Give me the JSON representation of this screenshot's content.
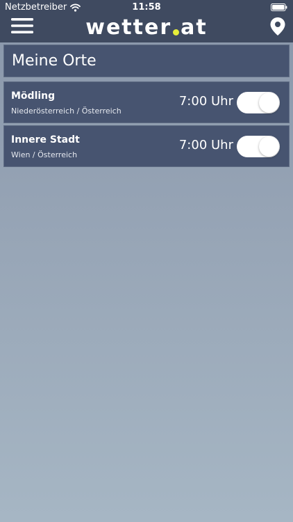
{
  "status_bar": {
    "carrier": "Netzbetreiber",
    "time": "11:58",
    "icons": [
      "wifi-icon",
      "battery-icon"
    ]
  },
  "header": {
    "logo_left": "wetter",
    "logo_right": "at",
    "logo_dot_color": "#e6ee3a",
    "icons": [
      "menu-icon",
      "location-pin-icon"
    ]
  },
  "main": {
    "title": "Meine Orte",
    "places": [
      {
        "name": "Mödling",
        "region": "Niederösterreich / Österreich",
        "time": "7:00 Uhr",
        "notification_enabled": true
      },
      {
        "name": "Innere Stadt",
        "region": "Wien / Österreich",
        "time": "7:00 Uhr",
        "notification_enabled": true
      }
    ]
  },
  "colors": {
    "header_bg": "#3f4a60",
    "card_bg": "#475470",
    "page_bg_top": "#8996aa",
    "page_bg_bottom": "#a6b6c4"
  }
}
